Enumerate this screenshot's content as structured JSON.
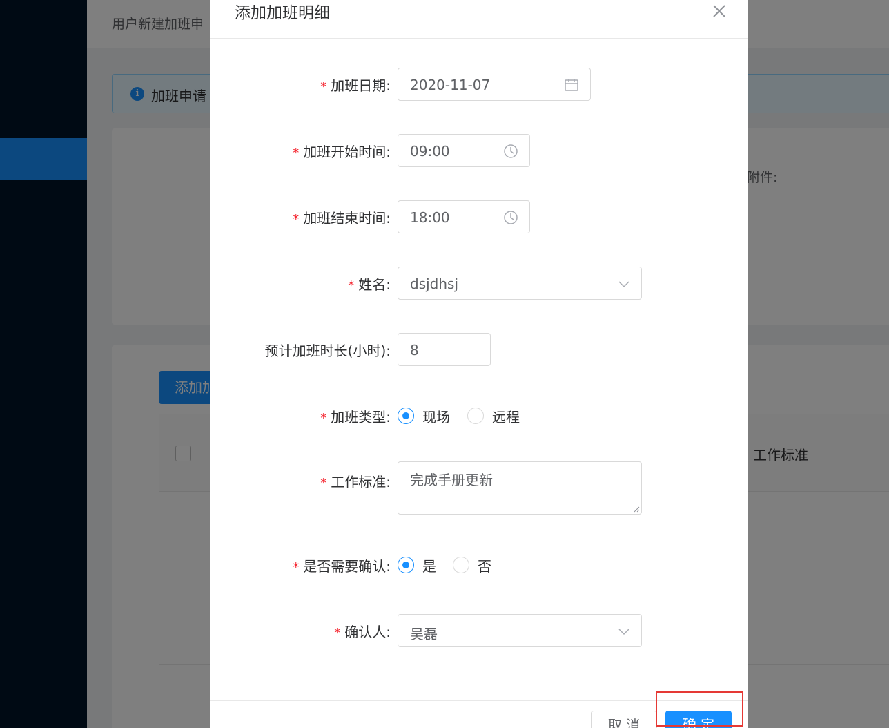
{
  "background": {
    "page_title": "用户新建加班申",
    "alert_text": "加班申请",
    "attachment_label": "附件:",
    "add_button_label": "添加加",
    "table_column_label": "工作标准"
  },
  "modal": {
    "title": "添加加班明细",
    "fields": {
      "date": {
        "label": "加班日期:",
        "value": "2020-11-07",
        "required": true
      },
      "start_time": {
        "label": "加班开始时间:",
        "value": "09:00",
        "required": true
      },
      "end_time": {
        "label": "加班结束时间:",
        "value": "18:00",
        "required": true
      },
      "name": {
        "label": "姓名:",
        "value": "dsjdhsj",
        "required": true
      },
      "duration": {
        "label": "预计加班时长(小时):",
        "value": "8",
        "required": false
      },
      "type": {
        "label": "加班类型:",
        "required": true,
        "options": [
          "现场",
          "远程"
        ],
        "selected": "现场"
      },
      "standard": {
        "label": "工作标准:",
        "value": "完成手册更新",
        "required": true
      },
      "need_confirm": {
        "label": "是否需要确认:",
        "required": true,
        "options": [
          "是",
          "否"
        ],
        "selected": "是"
      },
      "confirmer": {
        "label": "确认人:",
        "value": "吴磊",
        "required": true
      }
    },
    "footer": {
      "cancel_label": "取 消",
      "ok_label": "确 定"
    }
  },
  "colors": {
    "primary": "#1890ff",
    "required": "#f5222d",
    "highlight": "#e53935",
    "sidebar": "#001529"
  }
}
